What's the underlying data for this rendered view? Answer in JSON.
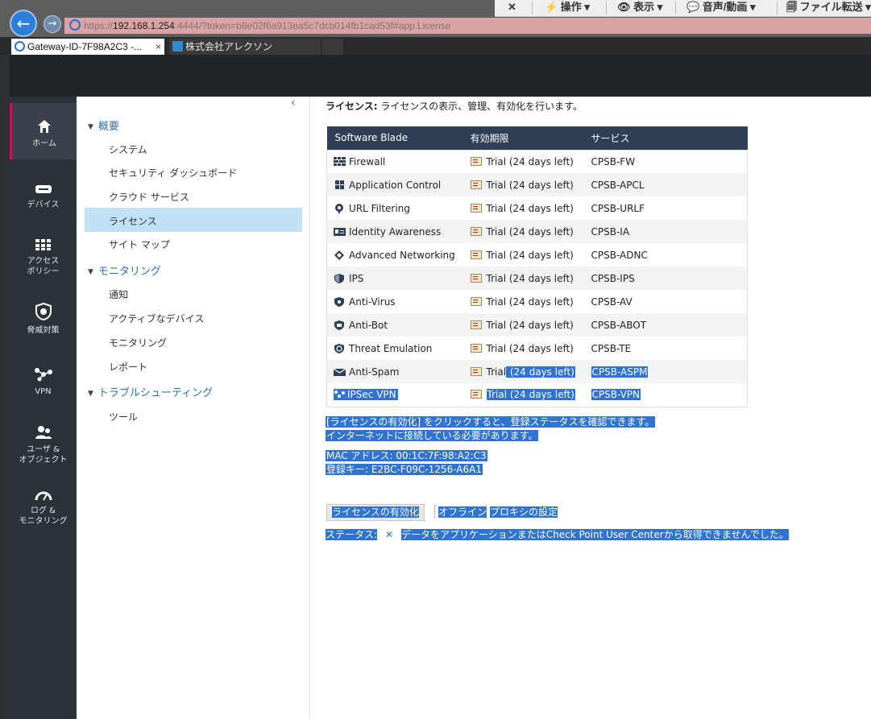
{
  "browser": {
    "url_scheme": "https://",
    "url_host": "192.168.1.254",
    "url_rest": ":4444/?token=b8e02f6a913ea5c7dcb014fb1cad53f#app.License",
    "tabs": [
      {
        "label": "Gateway-ID-7F98A2C3 -...",
        "close": "×"
      },
      {
        "label": "株式会社アレクソン"
      },
      {
        "label": ""
      }
    ],
    "remote_toolbar": {
      "close": "✕",
      "operate": "⚡ 操作 ▾",
      "view": "👁 表示 ▾",
      "av": "💬 音声/動画 ▾",
      "file": "🗐 ファイル転送 ▾"
    }
  },
  "leftnav": [
    {
      "label": "ホーム",
      "icon": "home-icon",
      "active": true
    },
    {
      "label": "デバイス",
      "icon": "device-icon"
    },
    {
      "label": "アクセス\nポリシー",
      "icon": "grid-icon"
    },
    {
      "label": "脅威対策",
      "icon": "shield-icon"
    },
    {
      "label": "VPN",
      "icon": "vpn-icon"
    },
    {
      "label": "ユーザ &\nオブジェクト",
      "icon": "users-icon"
    },
    {
      "label": "ログ &\nモニタリング",
      "icon": "gauge-icon"
    }
  ],
  "tree": {
    "collapse": "‹",
    "sections": [
      {
        "title": "概要",
        "items": [
          "システム",
          "セキュリティ ダッシュボード",
          "クラウド サービス",
          "ライセンス",
          "サイト マップ"
        ]
      },
      {
        "title": "モニタリング",
        "items": [
          "通知",
          "アクティブなデバイス",
          "モニタリング",
          "レポート"
        ]
      },
      {
        "title": "トラブルシューティング",
        "items": [
          "ツール"
        ]
      }
    ]
  },
  "main": {
    "desc_label": "ライセンス:",
    "desc_text": " ライセンスの表示、管理、有効化を行います。",
    "table": {
      "headers": [
        "Software Blade",
        "有効期限",
        "サービス"
      ],
      "rows": [
        {
          "blade": "Firewall",
          "icon": "firewall-icon",
          "status": "Trial (24 days left)",
          "service": "CPSB-FW"
        },
        {
          "blade": "Application Control",
          "icon": "apps-icon",
          "status": "Trial (24 days left)",
          "service": "CPSB-APCL"
        },
        {
          "blade": "URL Filtering",
          "icon": "url-icon",
          "status": "Trial (24 days left)",
          "service": "CPSB-URLF"
        },
        {
          "blade": "Identity Awareness",
          "icon": "id-card-icon",
          "status": "Trial (24 days left)",
          "service": "CPSB-IA"
        },
        {
          "blade": "Advanced Networking",
          "icon": "network-icon",
          "status": "Trial (24 days left)",
          "service": "CPSB-ADNC"
        },
        {
          "blade": "IPS",
          "icon": "ips-shield-icon",
          "status": "Trial (24 days left)",
          "service": "CPSB-IPS"
        },
        {
          "blade": "Anti-Virus",
          "icon": "antivirus-icon",
          "status": "Trial (24 days left)",
          "service": "CPSB-AV"
        },
        {
          "blade": "Anti-Bot",
          "icon": "antibot-icon",
          "status": "Trial (24 days left)",
          "service": "CPSB-ABOT"
        },
        {
          "blade": "Threat Emulation",
          "icon": "emulation-icon",
          "status": "Trial (24 days left)",
          "service": "CPSB-TE"
        },
        {
          "blade": "Anti-Spam",
          "icon": "mail-icon",
          "status_a": "Trial",
          "status_b": " (24 days left)",
          "service": "CPSB-ASPM"
        },
        {
          "blade": "IPSec VPN",
          "icon": "vpn-icon",
          "status": "Trial (24 days left)",
          "service": "CPSB-VPN"
        }
      ]
    },
    "info_line1": "[ライセンスの有効化] をクリックすると、登録ステータスを確認できます。",
    "info_line2": "インターネットに接続している必要があります。",
    "mac_line": "MAC アドレス: 00:1C:7F:98:A2:C3",
    "key_line": "登録キー: E2BC-F09C-1256-A6A1",
    "activate_button": "ライセンスの有効化",
    "offline_link": "オフライン",
    "proxy_link": "プロキシの設定",
    "status_label": "ステータス:",
    "status_mark": "✕",
    "status_text": "データをアプリケーションまたはCheck Point User Centerから取得できませんでした。"
  },
  "colors": {
    "selection": "#2f73d3",
    "table_header": "#2e3f56",
    "tree_selected": "#bfe2f7",
    "nav_active_accent": "#c2185b"
  }
}
